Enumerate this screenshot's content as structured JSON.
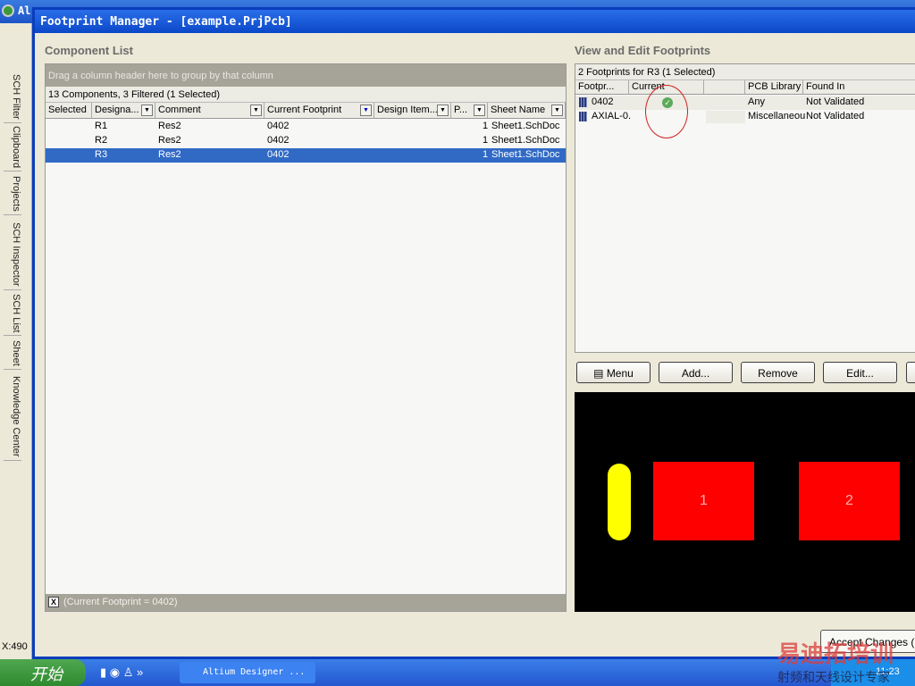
{
  "app": {
    "title": "Al",
    "status_coord": "X:490",
    "side_tabs": [
      "SCH Filter",
      "Clipboard",
      "Projects",
      "SCH Inspector",
      "SCH List",
      "Sheet",
      "Knowledge Center"
    ]
  },
  "dialog": {
    "title": "Footprint Manager - [example.PrjPcb]",
    "component_list": {
      "heading": "Component List",
      "group_hint": "Drag a column header here to group by that column",
      "count": "13 Components, 3 Filtered (1 Selected)",
      "columns": [
        "Selected",
        "Designa...",
        "Comment",
        "Current Footprint",
        "Design Item...",
        "P...",
        "Sheet Name"
      ],
      "rows": [
        {
          "designator": "R1",
          "comment": "Res2",
          "footprint": "0402",
          "p": "1",
          "sheet": "Sheet1.SchDoc"
        },
        {
          "designator": "R2",
          "comment": "Res2",
          "footprint": "0402",
          "p": "1",
          "sheet": "Sheet1.SchDoc"
        },
        {
          "designator": "R3",
          "comment": "Res2",
          "footprint": "0402",
          "p": "1",
          "sheet": "Sheet1.SchDoc",
          "selected": true
        }
      ],
      "filter": "(Current Footprint = 0402)"
    },
    "footprints": {
      "heading": "View and Edit Footprints",
      "count": "2 Footprints for R3 (1 Selected)",
      "columns": [
        "Footpr...",
        "Current",
        "",
        "PCB Library",
        "Found In"
      ],
      "rows": [
        {
          "name": "0402",
          "library": "Any",
          "found": "Not Validated",
          "current": true
        },
        {
          "name": "AXIAL-0.",
          "library": "Miscellaneou",
          "found": "Not Validated",
          "current": false
        }
      ]
    },
    "buttons": {
      "menu": "Menu",
      "add": "Add...",
      "remove": "Remove",
      "edit": "Edit...",
      "accept": "Accept Changes (Cr"
    },
    "preview": {
      "pad1": "1",
      "pad2": "2",
      "pad_color": "#ff0000",
      "body_color": "#ffff00"
    }
  },
  "taskbar": {
    "start": "开始",
    "task": "Altium Designer ...",
    "clock": "11:23"
  },
  "watermark": {
    "line1": "易迪拓培训",
    "line2": "射频和天线设计专家"
  }
}
